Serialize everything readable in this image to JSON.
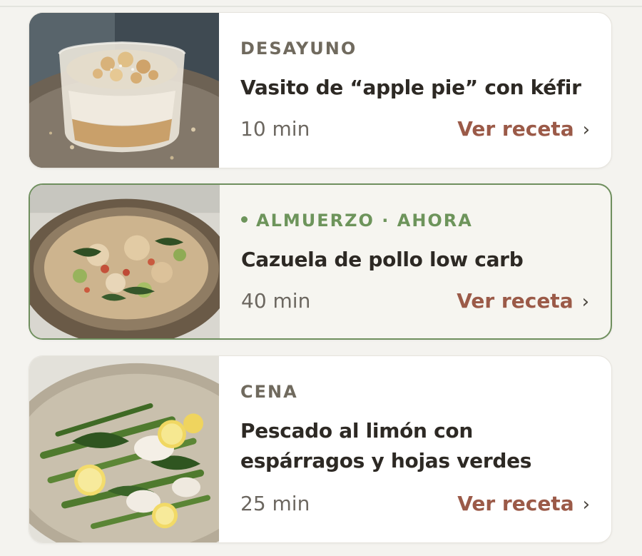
{
  "meals": [
    {
      "label": "DESAYUNO",
      "title": "Vasito de “apple pie” con kéfir",
      "time": "10 min",
      "link": "Ver receta",
      "image": "apple-pie-kefir-cup-photo"
    },
    {
      "label": "ALMUERZO · AHORA",
      "title": "Cazuela de pollo low carb",
      "time": "40 min",
      "link": "Ver receta",
      "image": "chicken-stew-bowl-photo",
      "current": true
    },
    {
      "label": "CENA",
      "title": "Pescado al limón con espárragos y hojas verdes",
      "time": "25 min",
      "link": "Ver receta",
      "image": "lemon-fish-asparagus-plate-photo"
    }
  ],
  "colors": {
    "background": "#f4f3ef",
    "card": "#ffffff",
    "active_card": "#f6f5f0",
    "active_border": "#6f8f5e",
    "label": "#706a5e",
    "label_now": "#6d945b",
    "title": "#2d2924",
    "link": "#9b5a48"
  },
  "icons": {
    "chevron": "chevron-right-icon",
    "now_indicator": "status-dot-icon"
  }
}
